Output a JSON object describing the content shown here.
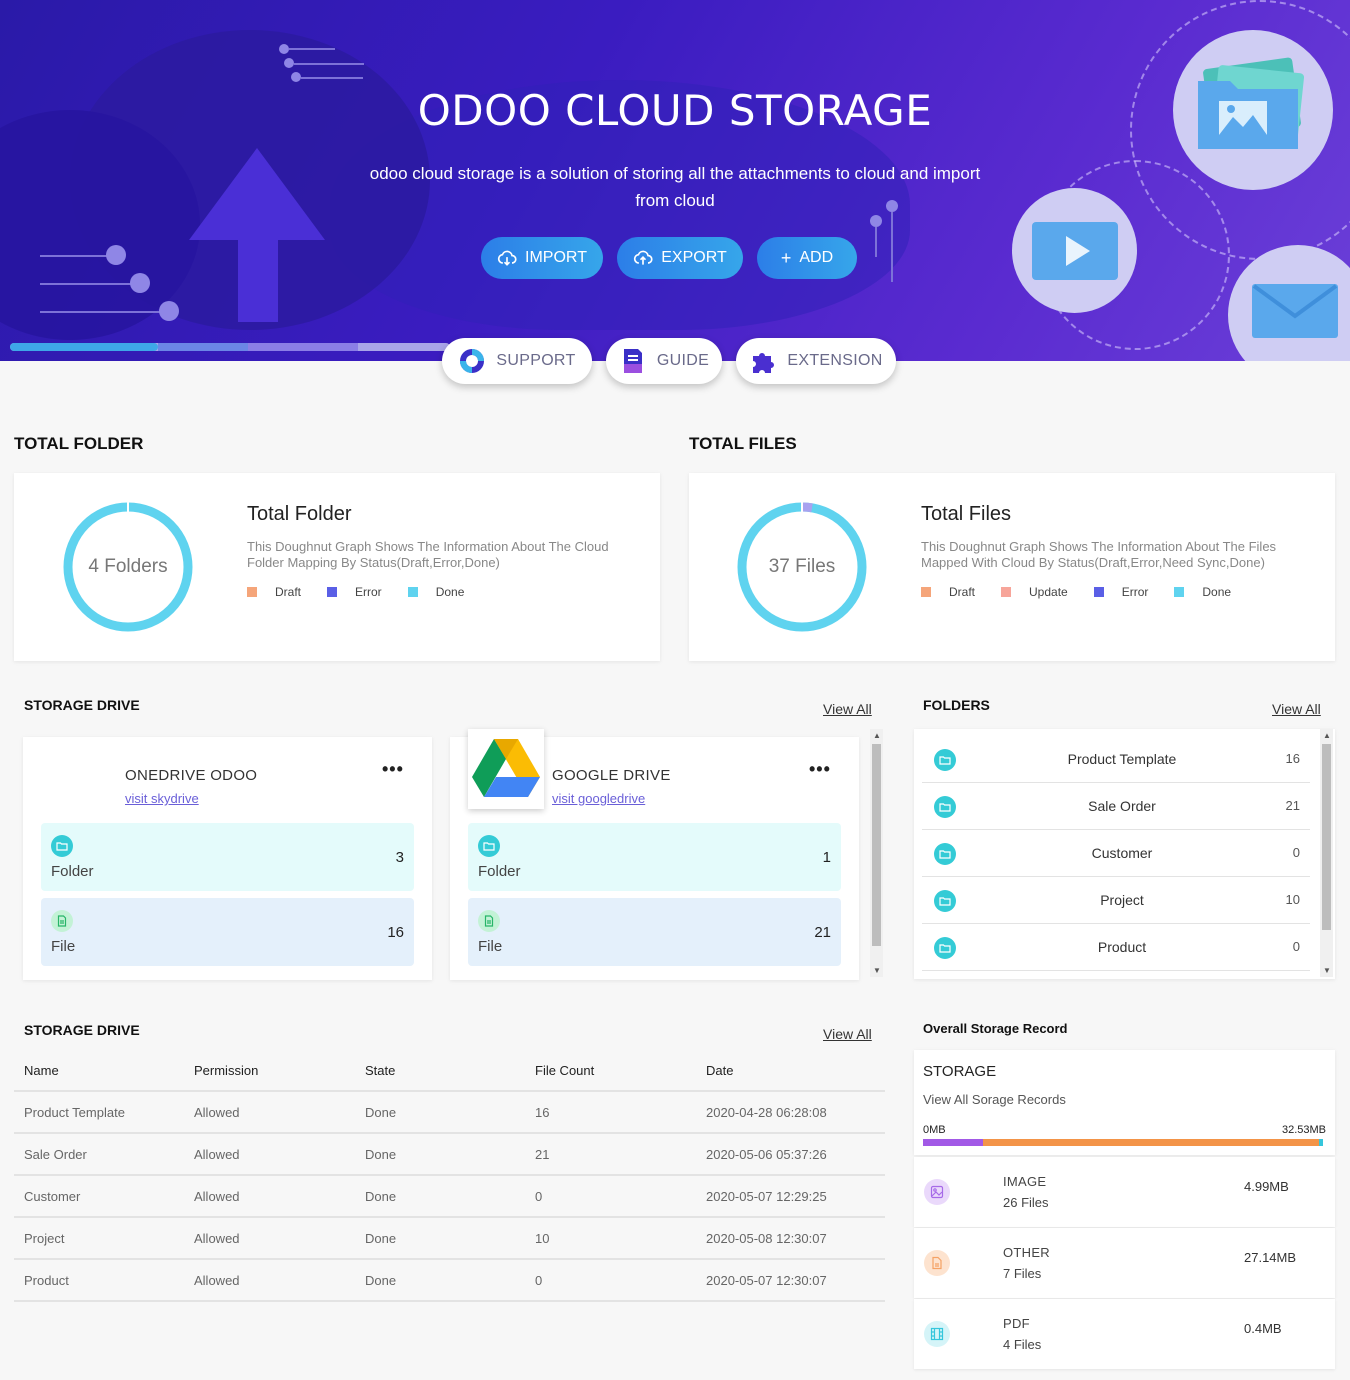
{
  "hero": {
    "title": "ODOO CLOUD STORAGE",
    "subtitle": "odoo cloud storage is a solution of storing all the attachments to cloud and import from cloud",
    "buttons": [
      {
        "label": "IMPORT",
        "icon": "cloud-download-icon"
      },
      {
        "label": "EXPORT",
        "icon": "cloud-upload-icon"
      },
      {
        "label": "ADD",
        "icon": "plus-icon"
      }
    ],
    "pills": [
      {
        "label": "SUPPORT",
        "icon": "lifebuoy-icon"
      },
      {
        "label": "GUIDE",
        "icon": "guide-document-icon"
      },
      {
        "label": "EXTENSION",
        "icon": "puzzle-icon"
      }
    ]
  },
  "total_folder": {
    "section_title": "TOTAL FOLDER",
    "center_text": "4 Folders",
    "heading": "Total Folder",
    "description": "This Doughnut Graph Shows The Information About The Cloud Folder Mapping By Status(Draft,Error,Done)",
    "legend": [
      {
        "label": "Draft",
        "color": "#f5a57a"
      },
      {
        "label": "Error",
        "color": "#5a5fe6"
      },
      {
        "label": "Done",
        "color": "#5fd3ef"
      }
    ]
  },
  "total_files": {
    "section_title": "TOTAL FILES",
    "center_text": "37 Files",
    "heading": "Total Files",
    "description": "This Doughnut Graph Shows The Information About The Files Mapped With Cloud By Status(Draft,Error,Need Sync,Done)",
    "legend": [
      {
        "label": "Draft",
        "color": "#f5a57a"
      },
      {
        "label": "Update",
        "color": "#f7a59a"
      },
      {
        "label": "Error",
        "color": "#5a5fe6"
      },
      {
        "label": "Done",
        "color": "#5fd3ef"
      }
    ]
  },
  "storage_drive": {
    "section_title": "STORAGE DRIVE",
    "view_all": "View All",
    "drives": [
      {
        "name": "ONEDRIVE ODOO",
        "link": "visit skydrive",
        "menu": "•••",
        "folder_label": "Folder",
        "folder_count": "3",
        "file_label": "File",
        "file_count": "16"
      },
      {
        "name": "GOOGLE DRIVE",
        "link": "visit googledrive",
        "menu": "•••",
        "folder_label": "Folder",
        "folder_count": "1",
        "file_label": "File",
        "file_count": "21"
      }
    ]
  },
  "folders": {
    "section_title": "FOLDERS",
    "view_all": "View All",
    "items": [
      {
        "name": "Product Template",
        "count": "16"
      },
      {
        "name": "Sale Order",
        "count": "21"
      },
      {
        "name": "Customer",
        "count": "0"
      },
      {
        "name": "Project",
        "count": "10"
      },
      {
        "name": "Product",
        "count": "0"
      }
    ]
  },
  "storage_table": {
    "section_title": "STORAGE DRIVE",
    "view_all": "View All",
    "columns": [
      "Name",
      "Permission",
      "State",
      "File Count",
      "Date"
    ],
    "rows": [
      [
        "Product Template",
        "Allowed",
        "Done",
        "16",
        "2020-04-28 06:28:08"
      ],
      [
        "Sale Order",
        "Allowed",
        "Done",
        "21",
        "2020-05-06 05:37:26"
      ],
      [
        "Customer",
        "Allowed",
        "Done",
        "0",
        "2020-05-07 12:29:25"
      ],
      [
        "Project",
        "Allowed",
        "Done",
        "10",
        "2020-05-08 12:30:07"
      ],
      [
        "Product",
        "Allowed",
        "Done",
        "0",
        "2020-05-07 12:30:07"
      ]
    ]
  },
  "storage_record": {
    "section_title": "Overall Storage Record",
    "heading": "STORAGE",
    "subheading": "View All Sorage Records",
    "min_label": "0MB",
    "max_label": "32.53MB",
    "items": [
      {
        "type": "IMAGE",
        "files": "26 Files",
        "size": "4.99MB",
        "icon": "image-icon",
        "color": "#a66ae8",
        "bg": "#ead9fb"
      },
      {
        "type": "OTHER",
        "files": "7 Files",
        "size": "27.14MB",
        "icon": "document-icon",
        "color": "#f5a264",
        "bg": "#fde3cf"
      },
      {
        "type": "PDF",
        "files": "4 Files",
        "size": "0.4MB",
        "icon": "film-icon",
        "color": "#35c6dc",
        "bg": "#d5f4f8"
      }
    ]
  }
}
